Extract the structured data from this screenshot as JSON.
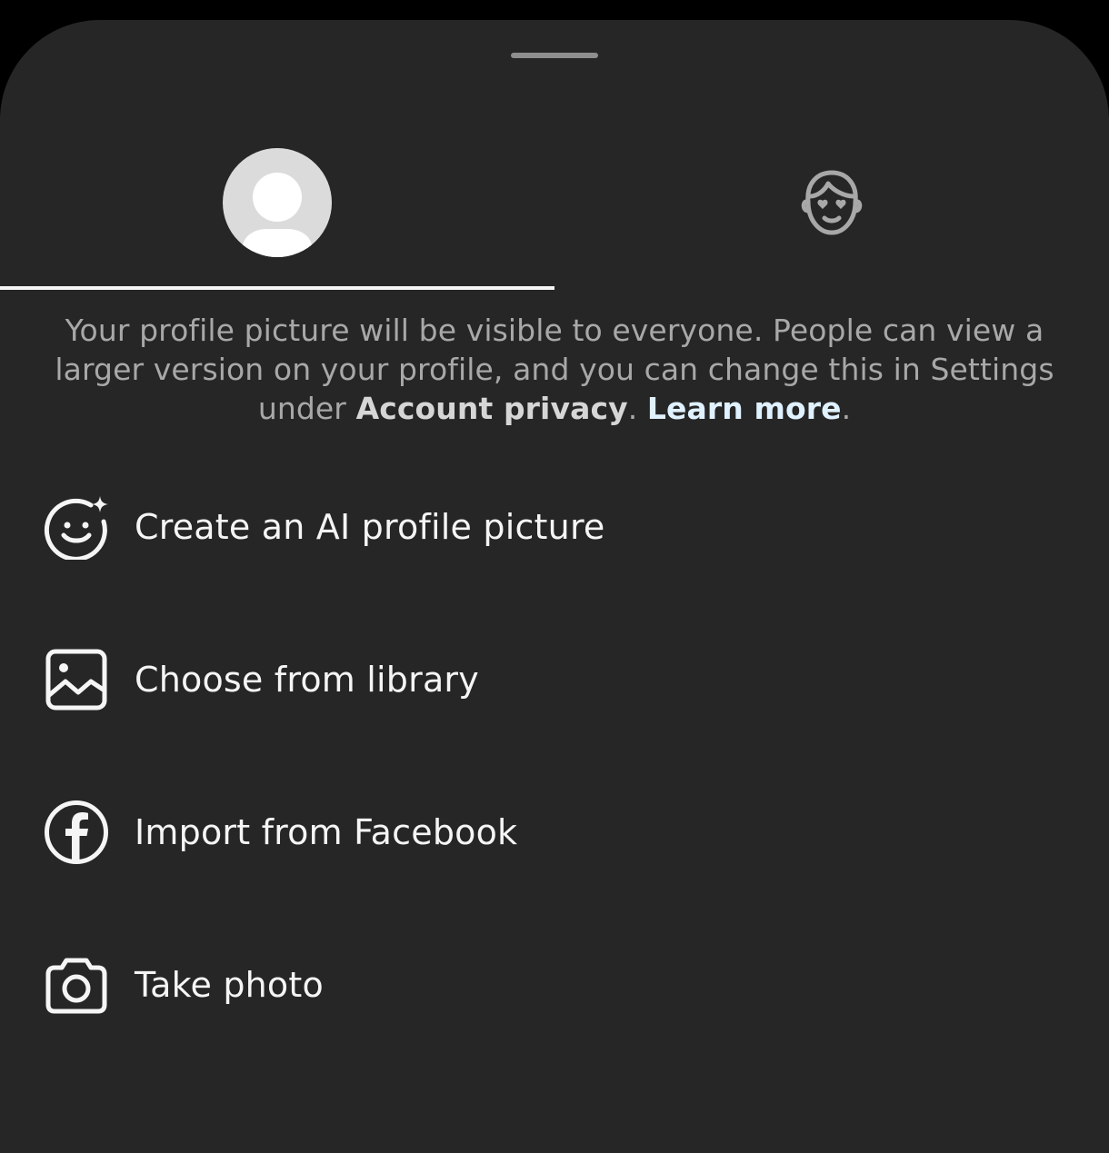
{
  "tabs": [
    {
      "name": "profile-picture",
      "icon": "default-avatar-icon",
      "selected": true
    },
    {
      "name": "avatar",
      "icon": "avatar-face-icon",
      "selected": false
    }
  ],
  "notice": {
    "text_before": "Your profile picture will be visible to everyone. People can view a larger version on your profile, and you can change this in Settings under ",
    "bold_setting": "Account privacy",
    "text_middle": ". ",
    "link": "Learn more",
    "text_after": "."
  },
  "menu": {
    "items": [
      {
        "label": "Create an AI profile picture",
        "icon": "ai-sparkle-face-icon"
      },
      {
        "label": "Choose from library",
        "icon": "image-library-icon"
      },
      {
        "label": "Import from Facebook",
        "icon": "facebook-icon"
      },
      {
        "label": "Take photo",
        "icon": "camera-icon"
      }
    ]
  },
  "colors": {
    "background": "#262626",
    "text_primary": "#f5f5f5",
    "text_secondary": "#a8a8a8",
    "link": "#e0f1ff"
  }
}
